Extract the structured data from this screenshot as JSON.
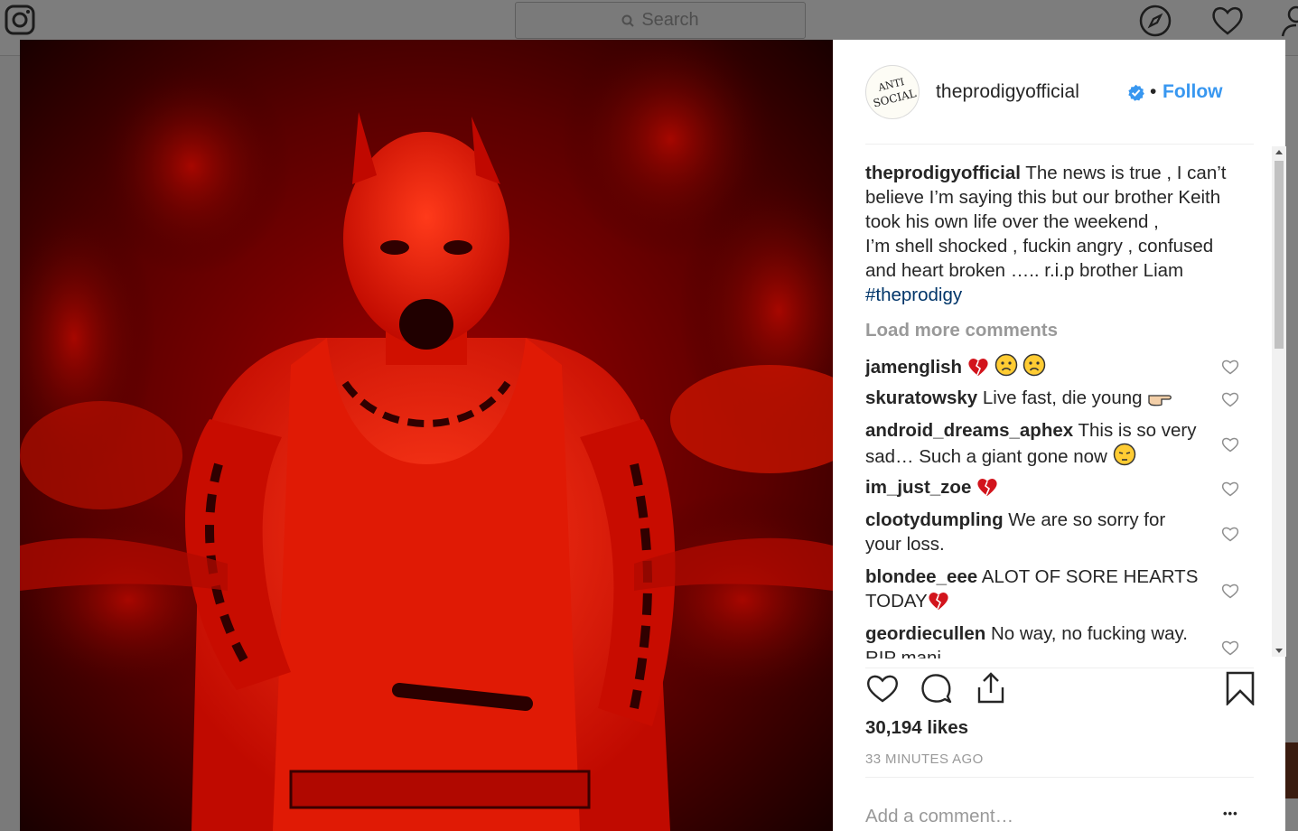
{
  "navbar": {
    "search_placeholder": "Search"
  },
  "post": {
    "username": "theprodigyofficial",
    "avatar_text_line1": "ANTI",
    "avatar_text_line2": "SOCIAL",
    "separator": "•",
    "follow_label": "Follow",
    "caption_user": "theprodigyofficial",
    "caption_lines": [
      " The news is true , I can’t",
      "believe I’m saying this but our brother Keith",
      "took his own life over the weekend ,",
      "I’m shell shocked , fuckin angry , confused",
      "and heart broken ….. r.i.p brother Liam"
    ],
    "hashtag": "#theprodigy",
    "load_more_label": "Load more comments",
    "comments": [
      {
        "user": "jamenglish",
        "text": ""
      },
      {
        "user": "skuratowsky",
        "text": " Live fast, die young"
      },
      {
        "user": "android_dreams_aphex",
        "text": " This is so very",
        "text2": "sad… Such a giant gone now"
      },
      {
        "user": "im_just_zoe",
        "text": ""
      },
      {
        "user": "clootydumpling",
        "text": " We are so sorry for",
        "text2": "your loss."
      },
      {
        "user": "blondee_eee",
        "text": " ALOT OF SORE HEARTS",
        "text2": "TODAY"
      },
      {
        "user": "geordiecullen",
        "text": " No way, no fucking way.",
        "text2": "RIP mani"
      }
    ],
    "likes": "30,194 likes",
    "time_ago": "33 MINUTES AGO",
    "add_comment_placeholder": "Add a comment…",
    "more_options": "•••"
  },
  "colors": {
    "link_blue": "#3897f0",
    "hashtag": "#003569",
    "muted": "#999999",
    "text": "#262626"
  }
}
